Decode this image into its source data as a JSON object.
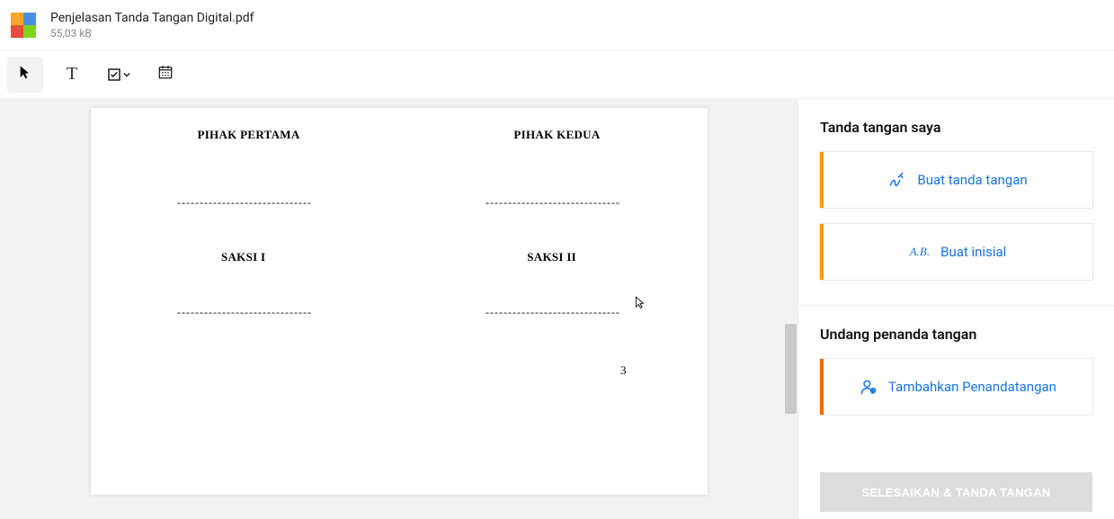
{
  "header": {
    "file_name": "Penjelasan Tanda Tangan Digital.pdf",
    "file_size": "55,03 kB"
  },
  "toolbar": {
    "tools": [
      {
        "name": "pointer",
        "active": true
      },
      {
        "name": "text",
        "active": false
      },
      {
        "name": "checkbox",
        "active": false
      },
      {
        "name": "date",
        "active": false
      }
    ]
  },
  "document": {
    "parties": {
      "left_top": "PIHAK PERTAMA",
      "right_top": "PIHAK KEDUA",
      "left_bottom": "SAKSI  I",
      "right_bottom": "SAKSI II"
    },
    "dots_line": "------------------------------",
    "page_number": "3"
  },
  "sidepanel": {
    "section_my_sign": "Tanda tangan saya",
    "create_signature": "Buat tanda tangan",
    "create_initials_prefix": "A.B.",
    "create_initials": "Buat inisial",
    "section_invite": "Undang penanda tangan",
    "add_signer": "Tambahkan Penandatangan",
    "finish_label": "SELESAIKAN & TANDA TANGAN"
  }
}
